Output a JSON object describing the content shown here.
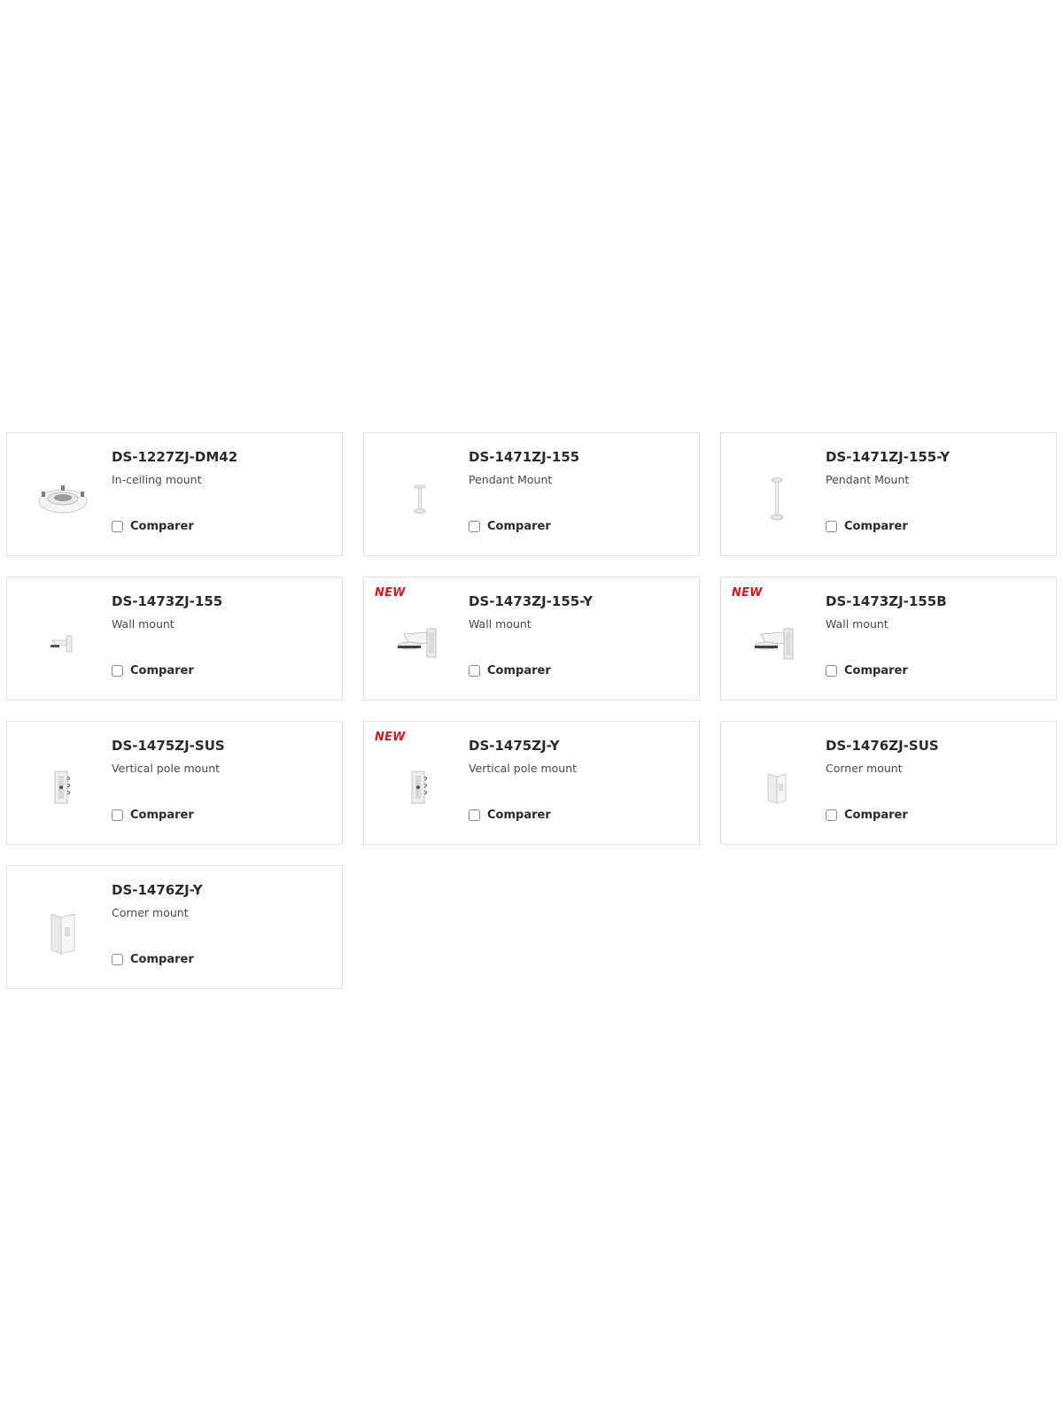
{
  "compare_label": "Comparer",
  "new_badge": "NEW",
  "products": [
    {
      "model": "DS-1227ZJ-DM42",
      "description": "In-ceiling mount",
      "is_new": false,
      "icon": "in-ceiling-mount-icon"
    },
    {
      "model": "DS-1471ZJ-155",
      "description": "Pendant Mount",
      "is_new": false,
      "icon": "pendant-mount-small-icon"
    },
    {
      "model": "DS-1471ZJ-155-Y",
      "description": "Pendant Mount",
      "is_new": false,
      "icon": "pendant-mount-tall-icon"
    },
    {
      "model": "DS-1473ZJ-155",
      "description": "Wall mount",
      "is_new": false,
      "icon": "wall-mount-small-icon"
    },
    {
      "model": "DS-1473ZJ-155-Y",
      "description": "Wall mount",
      "is_new": true,
      "icon": "wall-mount-icon"
    },
    {
      "model": "DS-1473ZJ-155B",
      "description": "Wall mount",
      "is_new": true,
      "icon": "wall-mount-icon"
    },
    {
      "model": "DS-1475ZJ-SUS",
      "description": "Vertical pole mount",
      "is_new": false,
      "icon": "pole-mount-icon"
    },
    {
      "model": "DS-1475ZJ-Y",
      "description": "Vertical pole mount",
      "is_new": true,
      "icon": "pole-mount-icon"
    },
    {
      "model": "DS-1476ZJ-SUS",
      "description": "Corner mount",
      "is_new": false,
      "icon": "corner-mount-small-icon"
    },
    {
      "model": "DS-1476ZJ-Y",
      "description": "Corner mount",
      "is_new": false,
      "icon": "corner-mount-icon"
    }
  ],
  "colors": {
    "new_badge": "#d71920",
    "card_border": "#e3e3e3",
    "title": "#2b2b2b"
  }
}
